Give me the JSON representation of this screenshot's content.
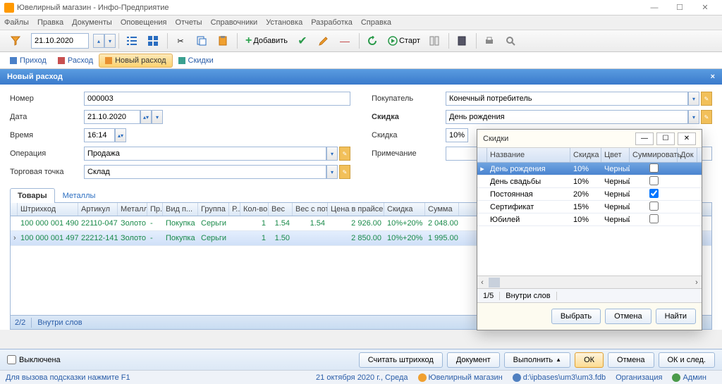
{
  "window": {
    "title": "Ювелирный магазин - Инфо-Предприятие"
  },
  "menu": [
    "Файлы",
    "Правка",
    "Документы",
    "Оповещения",
    "Отчеты",
    "Справочники",
    "Установка",
    "Разработка",
    "Справка"
  ],
  "toolbar": {
    "date": "21.10.2020",
    "add": "Добавить",
    "start": "Старт"
  },
  "doctabs": [
    {
      "label": "Приход",
      "color": "blue"
    },
    {
      "label": "Расход",
      "color": "red"
    },
    {
      "label": "Новый расход",
      "color": "orange",
      "active": true
    },
    {
      "label": "Скидки",
      "color": "teal"
    }
  ],
  "form": {
    "title": "Новый расход",
    "left": {
      "number_lbl": "Номер",
      "number": "000003",
      "date_lbl": "Дата",
      "date": "21.10.2020",
      "time_lbl": "Время",
      "time": "16:14",
      "op_lbl": "Операция",
      "op": "Продажа",
      "point_lbl": "Торговая точка",
      "point": "Склад"
    },
    "right": {
      "buyer_lbl": "Покупатель",
      "buyer": "Конечный потребитель",
      "discount_lbl": "Скидка",
      "discount": "День рождения",
      "discount2_lbl": "Скидка",
      "discount2": "10%",
      "note_lbl": "Примечание",
      "note": ""
    }
  },
  "subtabs": [
    "Товары",
    "Металлы"
  ],
  "grid": {
    "headers": [
      "Штрихкод",
      "Артикул",
      "Металл",
      "Пр...",
      "Вид п...",
      "Группа",
      "Р...",
      "Кол-во",
      "Вес",
      "Вес с пот.",
      "Цена в прайсе",
      "Скидка",
      "Сумма"
    ],
    "rows": [
      {
        "bar": "100 000 001 490",
        "art": "22110-047",
        "met": "Золото",
        "pr": "-",
        "vid": "Покупка",
        "grp": "Серьги",
        "r": "",
        "kol": "1",
        "ves": "1.54",
        "vsp": "1.54",
        "price": "2 926.00",
        "sk": "10%+20%",
        "sum": "2 048.00"
      },
      {
        "bar": "100 000 001 497",
        "art": "22212-141",
        "met": "Золото",
        "pr": "-",
        "vid": "Покупка",
        "grp": "Серьги",
        "r": "",
        "kol": "1",
        "ves": "1.50",
        "vsp": "",
        "price": "2 850.00",
        "sk": "10%+20%",
        "sum": "1 995.00"
      }
    ],
    "footer": {
      "count": "2/2",
      "search": "Внутри слов"
    }
  },
  "actions": {
    "off": "Выключена",
    "read_barcode": "Считать штрихкод",
    "document": "Документ",
    "execute": "Выполнить",
    "ok": "ОК",
    "cancel": "Отмена",
    "ok_next": "ОК и след."
  },
  "status": {
    "hint": "Для вызова подсказки нажмите F1",
    "date": "21 октября 2020 г., Среда",
    "store": "Ювелирный магазин",
    "db": "d:\\ipbases\\um3\\um3.fdb",
    "org": "Организация",
    "user": "Админ"
  },
  "popup": {
    "title": "Скидки",
    "headers": [
      "Название",
      "Скидка",
      "Цвет",
      "Суммировать",
      "Док"
    ],
    "rows": [
      {
        "name": "День рождения",
        "sk": "10%",
        "col": "Черный",
        "sum": false,
        "sel": true
      },
      {
        "name": "День свадьбы",
        "sk": "10%",
        "col": "Черный",
        "sum": false
      },
      {
        "name": "Постоянная",
        "sk": "20%",
        "col": "Черный",
        "sum": true
      },
      {
        "name": "Сертификат",
        "sk": "15%",
        "col": "Черный",
        "sum": false
      },
      {
        "name": "Юбилей",
        "sk": "10%",
        "col": "Черный",
        "sum": false
      }
    ],
    "page": "1/5",
    "search": "Внутри слов",
    "select": "Выбрать",
    "cancel": "Отмена",
    "find": "Найти"
  }
}
